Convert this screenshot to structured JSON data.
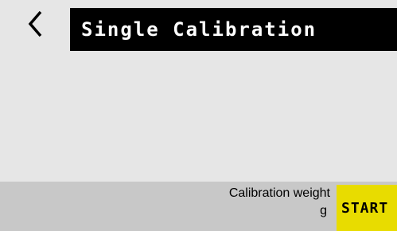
{
  "header": {
    "back_icon": "chevron-left-icon",
    "title": "Single Calibration"
  },
  "calibration": {
    "weight_label": "Calibration weight",
    "unit": "g",
    "start_label": "START"
  },
  "colors": {
    "background": "#e6e6e6",
    "title_bar": "#000000",
    "title_text": "#ffffff",
    "bottom_bar": "#c8c8c8",
    "start_button": "#e8dc00"
  }
}
